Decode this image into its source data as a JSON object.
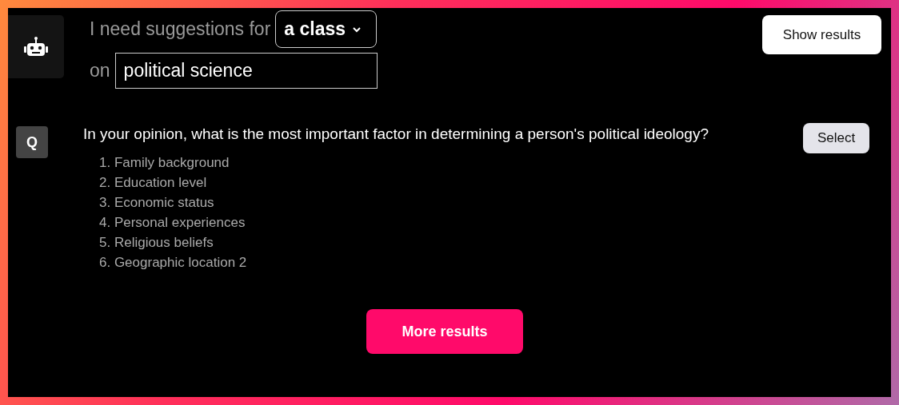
{
  "header": {
    "prompt_prefix": "I need suggestions for",
    "dropdown": {
      "value": "a class"
    },
    "topic_label": "on",
    "topic_field": {
      "value": "political science"
    },
    "show_button": "Show results"
  },
  "results": [
    {
      "badge": "Q",
      "question": "In your opinion, what is the most important factor in determining a person's political ideology?",
      "select_button": "Select",
      "options": [
        "1. Family background",
        "2. Education level",
        "3. Economic status",
        "4. Personal experiences",
        "5. Religious beliefs",
        "6. Geographic location 2"
      ]
    }
  ],
  "more_button": "More results"
}
